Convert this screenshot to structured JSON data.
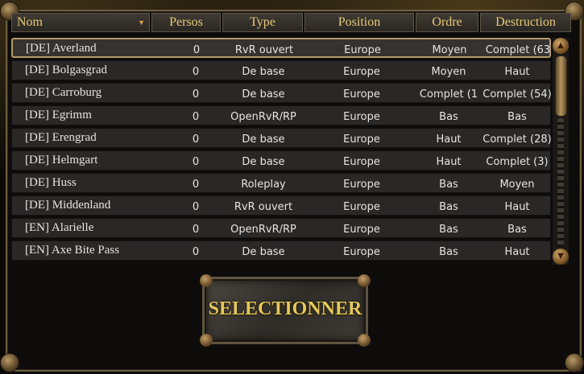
{
  "columns": {
    "nom": "Nom",
    "persos": "Persos",
    "type": "Type",
    "position": "Position",
    "ordre": "Ordre",
    "destruction": "Destruction"
  },
  "rows": [
    {
      "name": "[DE] Averland",
      "persos": "0",
      "type": "RvR ouvert",
      "position": "Europe",
      "ordre": "Moyen",
      "destruction": "Complet (63"
    },
    {
      "name": "[DE] Bolgasgrad",
      "persos": "0",
      "type": "De base",
      "position": "Europe",
      "ordre": "Moyen",
      "destruction": "Haut"
    },
    {
      "name": "[DE] Carroburg",
      "persos": "0",
      "type": "De base",
      "position": "Europe",
      "ordre": "Complet (1",
      "destruction": "Complet (54)"
    },
    {
      "name": "[DE] Egrimm",
      "persos": "0",
      "type": "OpenRvR/RP",
      "position": "Europe",
      "ordre": "Bas",
      "destruction": "Bas"
    },
    {
      "name": "[DE] Erengrad",
      "persos": "0",
      "type": "De base",
      "position": "Europe",
      "ordre": "Haut",
      "destruction": "Complet (28)"
    },
    {
      "name": "[DE] Helmgart",
      "persos": "0",
      "type": "De base",
      "position": "Europe",
      "ordre": "Haut",
      "destruction": "Complet (3)"
    },
    {
      "name": "[DE] Huss",
      "persos": "0",
      "type": "Roleplay",
      "position": "Europe",
      "ordre": "Bas",
      "destruction": "Moyen"
    },
    {
      "name": "[DE] Middenland",
      "persos": "0",
      "type": "RvR ouvert",
      "position": "Europe",
      "ordre": "Bas",
      "destruction": "Haut"
    },
    {
      "name": "[EN] Alarielle",
      "persos": "0",
      "type": "OpenRvR/RP",
      "position": "Europe",
      "ordre": "Bas",
      "destruction": "Bas"
    },
    {
      "name": "[EN] Axe Bite Pass",
      "persos": "0",
      "type": "De base",
      "position": "Europe",
      "ordre": "Bas",
      "destruction": "Haut"
    }
  ],
  "selected_row": 0,
  "select_button": "SELECTIONNER",
  "icons": {
    "sort": "sort-desc-icon",
    "scroll_up": "scroll-up-icon",
    "scroll_down": "scroll-down-icon"
  }
}
